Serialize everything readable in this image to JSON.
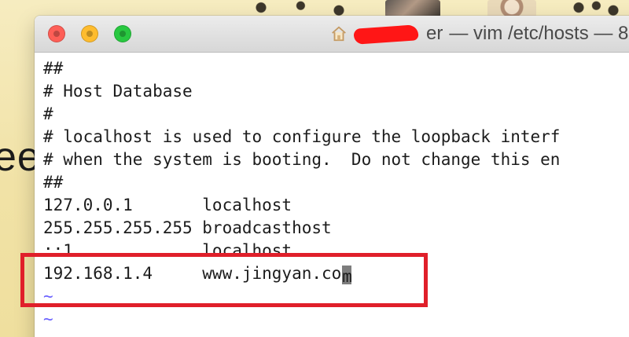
{
  "background": {
    "partial_word": "ee"
  },
  "window": {
    "title_prefix": "er",
    "title": "— vim /etc/hosts — 8",
    "traffic_lights": {
      "close_color": "#fe5f57",
      "minimize_color": "#febc2e",
      "zoom_color": "#28c840"
    }
  },
  "editor": {
    "lines": [
      "##",
      "# Host Database",
      "#",
      "# localhost is used to configure the loopback interf",
      "# when the system is booting.  Do not change this en",
      "##",
      "127.0.0.1       localhost",
      "255.255.255.255 broadcasthost",
      "::1             localhost",
      "192.168.1.4     www.jingyan.co"
    ],
    "cursor_char": "m",
    "empty_line_marker": "~"
  },
  "annotation": {
    "color": "#e01f2a"
  }
}
